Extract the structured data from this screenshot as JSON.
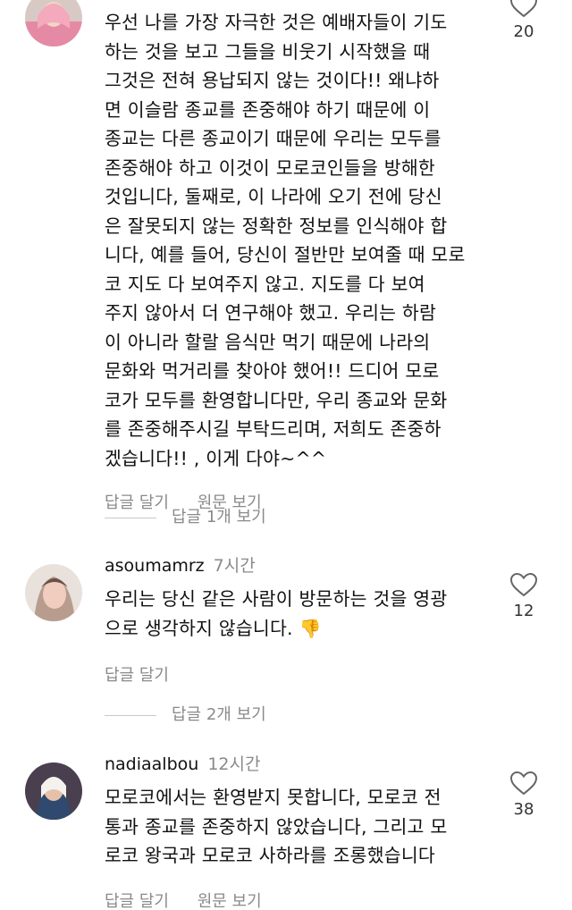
{
  "comments": [
    {
      "username": "",
      "time": "",
      "text": "우선 나를 가장 자극한 것은 예배자들이 기도\n하는 것을 보고 그들을 비웃기 시작했을 때\n그것은 전혀 용납되지 않는 것이다!! 왜냐하\n면 이슬람 종교를 존중해야 하기 때문에 이\n종교는 다른 종교이기 때문에 우리는 모두를\n존중해야 하고 이것이 모로코인들을 방해한\n것입니다, 둘째로, 이 나라에 오기 전에 당신\n은 잘못되지 않는 정확한 정보를 인식해야 합\n니다, 예를 들어, 당신이 절반만 보여줄 때 모로\n코 지도 다 보여주지 않고. 지도를 다 보여\n주지 않아서 더 연구해야 했고. 우리는 하람\n이 아니라 할랄 음식만 먹기 때문에 나라의\n문화와 먹거리를 찾아야 했어!! 드디어 모로\n코가 모두를 환영합니다만, 우리 종교와 문화\n를 존중해주시길 부탁드리며, 저희도 존중하\n겠습니다!! , 이게 다야~^^",
      "reply_label": "답글 달기",
      "translate_label": "원문 보기",
      "likes": "20",
      "view_replies": "답글 1개 보기"
    },
    {
      "username": "asoumamrz",
      "time": "7시간",
      "text": "우리는 당신 같은 사람이 방문하는 것을 영광\n으로 생각하지 않습니다.",
      "emoji": "👎",
      "reply_label": "답글 달기",
      "likes": "12",
      "view_replies": "답글 2개 보기"
    },
    {
      "username": "nadiaalbou",
      "time": "12시간",
      "text": "모로코에서는 환영받지 못합니다, 모로코 전\n통과 종교를 존중하지 않았습니다, 그리고 모\n로코 왕국과 모로코 사하라를 조롱했습니다",
      "reply_label": "답글 달기",
      "translate_label": "원문 보기",
      "likes": "38"
    }
  ],
  "icons": {
    "like": "heart-outline-icon",
    "dislike_emoji": "thumbs-down-emoji"
  },
  "colors": {
    "text": "#111111",
    "muted": "#8a8a8a",
    "divider": "#c8c8c8"
  }
}
